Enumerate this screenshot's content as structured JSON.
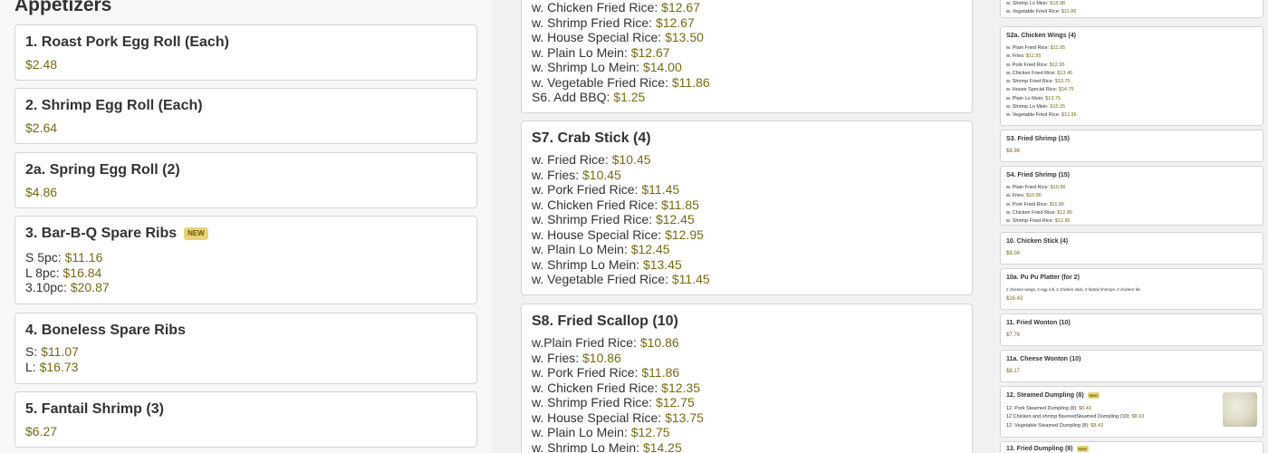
{
  "left": {
    "section_title": "Appetizers",
    "items": [
      {
        "title": "1. Roast Pork Egg Roll (Each)",
        "price": "$2.48"
      },
      {
        "title": "2. Shrimp Egg Roll (Each)",
        "price": "$2.64"
      },
      {
        "title": "2a. Spring Egg Roll (2)",
        "price": "$4.86"
      },
      {
        "title": "3. Bar-B-Q Spare Ribs",
        "badge": "NEW",
        "lines": [
          {
            "label": "S 5pc: ",
            "price": "$11.16"
          },
          {
            "label": "L 8pc: ",
            "price": "$16.84"
          },
          {
            "label": "3.10pc: ",
            "price": "$20.87"
          }
        ]
      },
      {
        "title": "4. Boneless Spare Ribs",
        "lines": [
          {
            "label": "S: ",
            "price": "$11.07"
          },
          {
            "label": "L: ",
            "price": "$16.73"
          }
        ]
      },
      {
        "title": "5. Fantail Shrimp (3)",
        "price": "$6.27"
      }
    ]
  },
  "middle": {
    "card1_lines": [
      {
        "label": "w. Chicken Fried Rice: ",
        "price": "$12.67"
      },
      {
        "label": "w. Shrimp Fried Rice: ",
        "price": "$12.67"
      },
      {
        "label": "w. House Special Rice: ",
        "price": "$13.50"
      },
      {
        "label": "w. Plain Lo Mein: ",
        "price": "$12.67"
      },
      {
        "label": "w. Shrimp Lo Mein: ",
        "price": "$14.00"
      },
      {
        "label": "w. Vegetable Fried Rice: ",
        "price": "$11.86"
      },
      {
        "label": "S6. Add BBQ: ",
        "price": "$1.25"
      }
    ],
    "card2": {
      "title": "S7. Crab Stick (4)",
      "lines": [
        {
          "label": "w. Fried Rice: ",
          "price": "$10.45"
        },
        {
          "label": "w. Fries: ",
          "price": "$10.45"
        },
        {
          "label": "w. Pork Fried Rice: ",
          "price": "$11.45"
        },
        {
          "label": "w. Chicken Fried Rice: ",
          "price": "$11.85"
        },
        {
          "label": "w. Shrimp Fried Rice: ",
          "price": "$12.45"
        },
        {
          "label": "w. House Special Rice: ",
          "price": "$12.95"
        },
        {
          "label": "w. Plain Lo Mein: ",
          "price": "$12.45"
        },
        {
          "label": "w. Shrimp Lo Mein: ",
          "price": "$13.45"
        },
        {
          "label": "w. Vegetable Fried Rice: ",
          "price": "$11.45"
        }
      ]
    },
    "card3": {
      "title": "S8. Fried Scallop (10)",
      "lines": [
        {
          "label": "w.Plain Fried Rice: ",
          "price": "$10.86"
        },
        {
          "label": "w. Fries: ",
          "price": "$10.86"
        },
        {
          "label": "w. Pork Fried Rice: ",
          "price": "$11.86"
        },
        {
          "label": "w. Chicken Fried Rice: ",
          "price": "$12.35"
        },
        {
          "label": "w. Shrimp Fried Rice: ",
          "price": "$12.75"
        },
        {
          "label": "w. House Special Rice: ",
          "price": "$13.75"
        },
        {
          "label": "w. Plain Lo Mein: ",
          "price": "$12.75"
        },
        {
          "label": "w. Shrimp Lo Mein: ",
          "price": "$14.25"
        }
      ]
    }
  },
  "right": {
    "top_lines": [
      {
        "label": "w. Shrimp Lo Mein: ",
        "price": "$13.98"
      },
      {
        "label": "w. Vegetable Fried Rice: ",
        "price": "$11.86"
      }
    ],
    "s2a": {
      "title": "S2a. Chicken Wings (4)",
      "lines": [
        {
          "label": "w. Plain Fried Rice: ",
          "price": "$11.95"
        },
        {
          "label": "w. Fries: ",
          "price": "$11.95"
        },
        {
          "label": "w. Pork Fried Rice: ",
          "price": "$12.95"
        },
        {
          "label": "w. Chicken Fried Rice: ",
          "price": "$13.45"
        },
        {
          "label": "w. Shrimp Fried Rice: ",
          "price": "$13.75"
        },
        {
          "label": "w. House Special Rice: ",
          "price": "$14.75"
        },
        {
          "label": "w. Plain Lo Mein: ",
          "price": "$13.75"
        },
        {
          "label": "w. Shrimp Lo Mein: ",
          "price": "$15.25"
        },
        {
          "label": "w. Vegetable Fried Rice: ",
          "price": "$12.95"
        }
      ]
    },
    "s3": {
      "title": "S3. Fried Shrimp (15)",
      "price": "$8.98"
    },
    "s4": {
      "title": "S4. Fried Shrimp (15)",
      "lines": [
        {
          "label": "w. Plain Fried Rice: ",
          "price": "$10.86"
        },
        {
          "label": "w. Fries: ",
          "price": "$10.86"
        },
        {
          "label": "w. Pork Fried Rice: ",
          "price": "$11.86"
        },
        {
          "label": "w. Chicken Fried Rice: ",
          "price": "$12.86"
        },
        {
          "label": "w. Shrimp Fried Rice: ",
          "price": "$12.86"
        }
      ]
    },
    "i10": {
      "title": "10. Chicken Stick (4)",
      "price": "$8.04"
    },
    "i10a": {
      "title": "10a. Pu Pu Platter (for 2)",
      "desc": "2 chicken wings, 2 egg roll, 2 chicken stick, 2 fantail shrimps, 2 chicken fat.",
      "price": "$16.43"
    },
    "i11": {
      "title": "11. Fried Wonton (10)",
      "price": "$7.76"
    },
    "i11a": {
      "title": "11a. Cheese Wonton (10)",
      "price": "$8.17"
    },
    "i12": {
      "title": "12. Steamed Dumpling (8)",
      "badge": "NEW",
      "lines": [
        {
          "label": "12. Pork Steamed Dumpling (8): ",
          "price": "$8.43"
        },
        {
          "label": "12.Chicken and shrimp flavoredSteamed Dumpling (10): ",
          "price": "$8.93"
        },
        {
          "label": "12. Vegetable Steamed Dumpling (8): ",
          "price": "$8.43"
        }
      ]
    },
    "i13": {
      "title": "13. Fried Dumpling (8)",
      "badge": "NEW"
    }
  }
}
